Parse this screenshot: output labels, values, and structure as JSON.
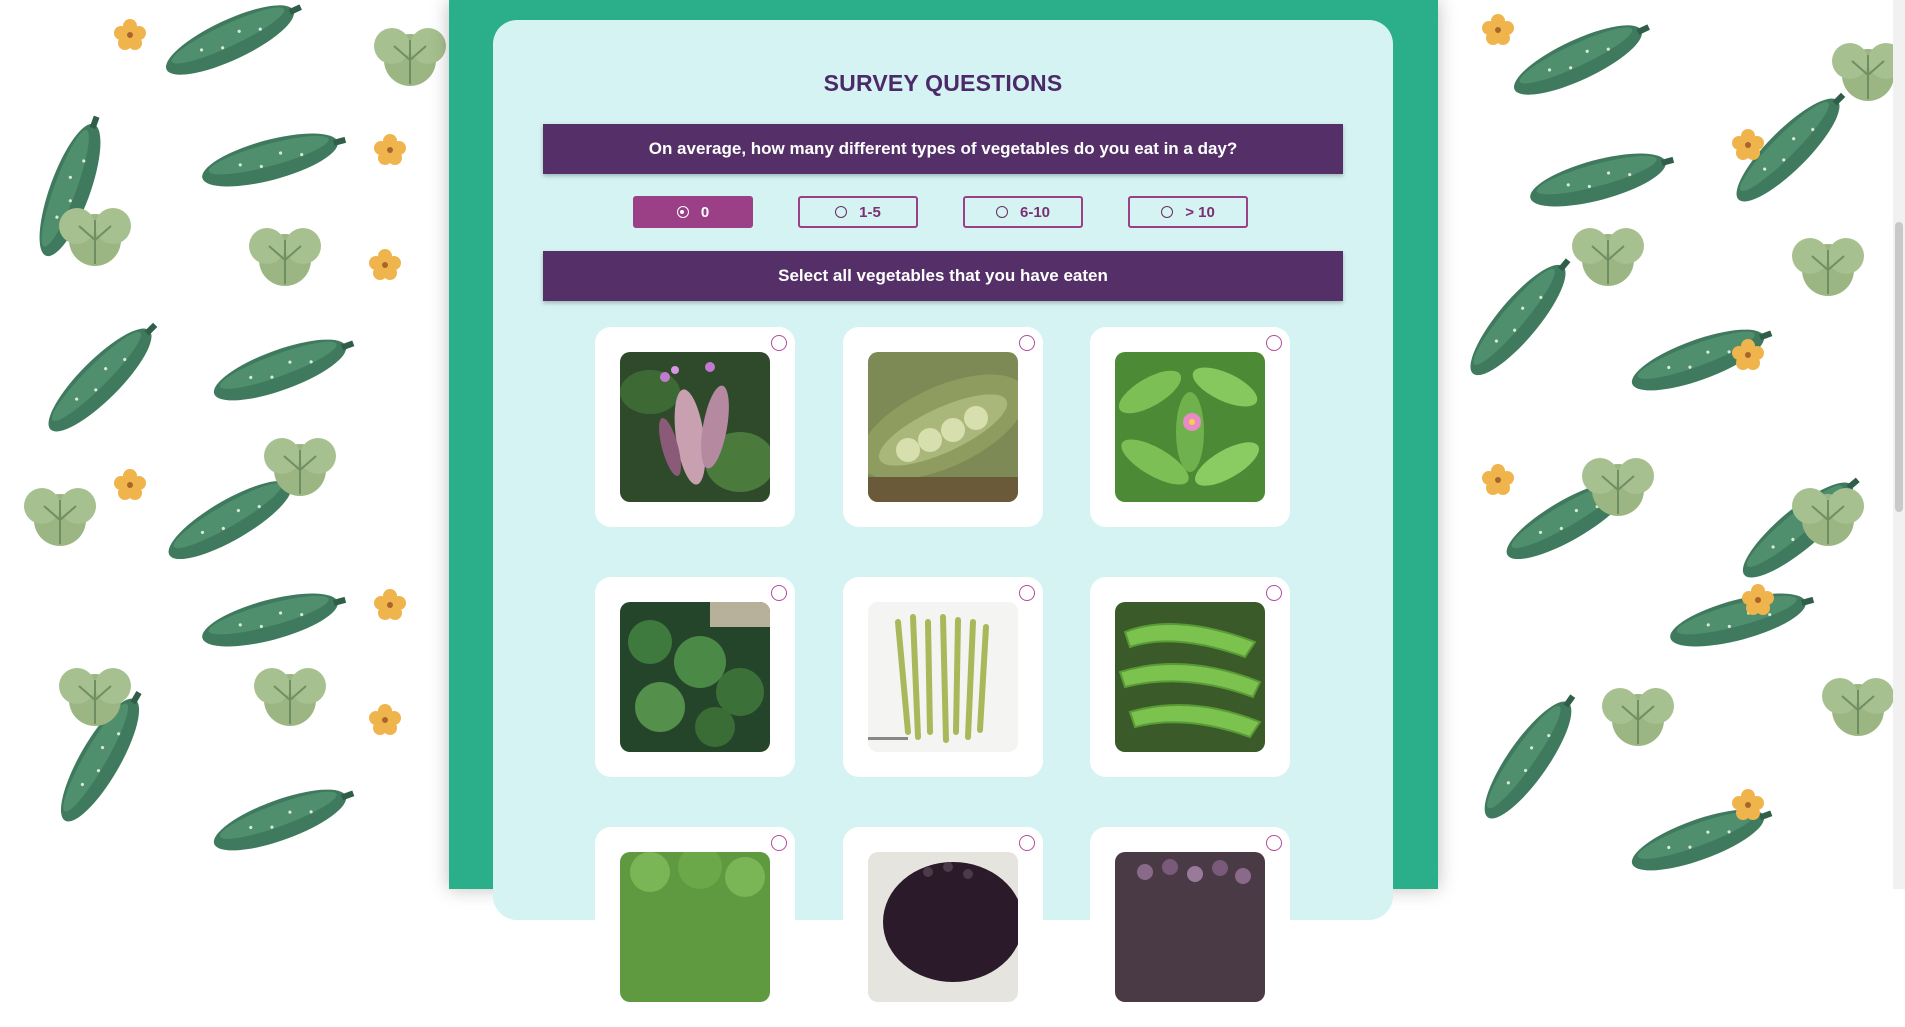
{
  "survey": {
    "title": "SURVEY QUESTIONS",
    "question1": "On average, how many different types of vegetables do you eat in a day?",
    "options": [
      {
        "label": "0",
        "selected": true
      },
      {
        "label": "1-5",
        "selected": false
      },
      {
        "label": "6-10",
        "selected": false
      },
      {
        "label": "> 10",
        "selected": false
      }
    ],
    "question2": "Select all vegetables that you have eaten"
  },
  "colors": {
    "frame": "#2bae8a",
    "card": "#d4f3f2",
    "question_bar": "#553068",
    "accent": "#9b3f86"
  },
  "vegetable_tiles": [
    {
      "image": "purple-hyacinth-bean-photo",
      "checked": false
    },
    {
      "image": "lima-bean-pod-photo",
      "checked": false
    },
    {
      "image": "talinum-leaf-photo",
      "checked": false
    },
    {
      "image": "malabar-spinach-photo",
      "checked": false
    },
    {
      "image": "green-bean-bundle-photo",
      "checked": false
    },
    {
      "image": "winged-bean-photo",
      "checked": false
    },
    {
      "image": "leafy-greens-photo",
      "checked": false
    },
    {
      "image": "dark-berries-photo",
      "checked": false
    },
    {
      "image": "purple-beans-photo",
      "checked": false
    }
  ]
}
